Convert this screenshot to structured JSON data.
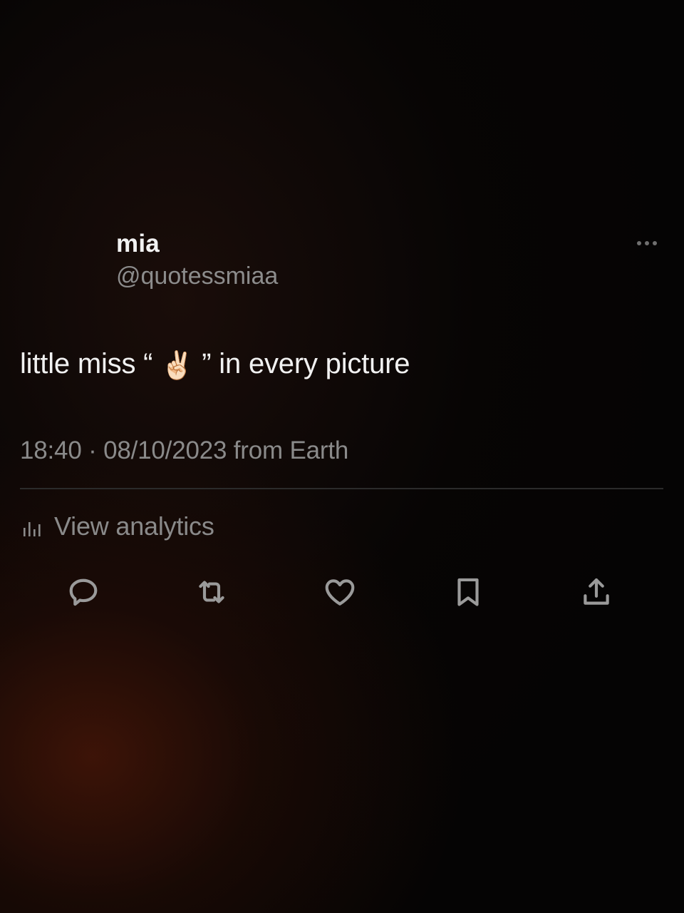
{
  "user": {
    "display_name": "mia",
    "handle": "@quotessmiaa"
  },
  "tweet": {
    "text_before": "little miss “",
    "emoji": "✌🏻",
    "text_after": "” in every picture",
    "meta": "18:40 · 08/10/2023 from Earth"
  },
  "analytics": {
    "label": "View analytics",
    "icon": "bar-chart-icon"
  },
  "actions": [
    {
      "name": "reply",
      "icon": "speech-bubble-icon"
    },
    {
      "name": "retweet",
      "icon": "retweet-arrows-icon"
    },
    {
      "name": "like",
      "icon": "heart-icon"
    },
    {
      "name": "bookmark",
      "icon": "bookmark-icon"
    },
    {
      "name": "share",
      "icon": "share-upload-icon"
    }
  ],
  "colors": {
    "background": "#050404",
    "primary_text": "#f1f1f1",
    "secondary_text": "#8a8a8a",
    "icon": "#9a9a9a",
    "divider": "#2b2b2b",
    "glow": "#46160a"
  }
}
